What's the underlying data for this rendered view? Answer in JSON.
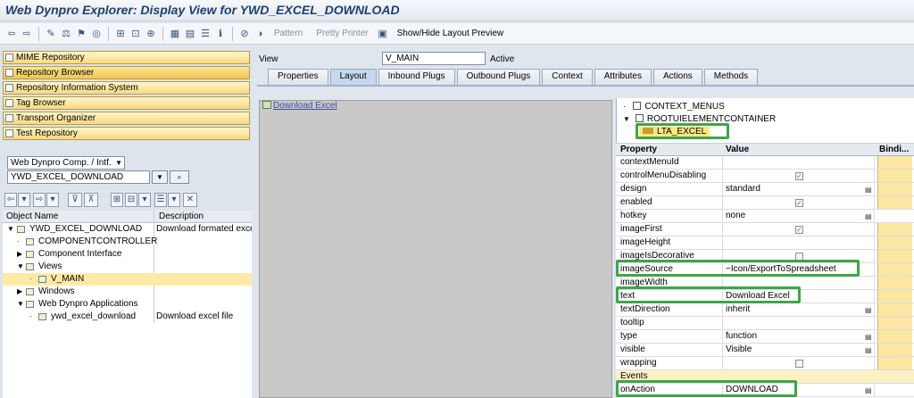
{
  "window": {
    "title": "Web Dynpro Explorer: Display View for YWD_EXCEL_DOWNLOAD"
  },
  "toolbar": {
    "pattern_label": "Pattern",
    "pretty_printer_label": "Pretty Printer",
    "layout_preview_label": "Show/Hide Layout Preview"
  },
  "nav": {
    "items": [
      {
        "label": "MIME Repository"
      },
      {
        "label": "Repository Browser"
      },
      {
        "label": "Repository Information System"
      },
      {
        "label": "Tag Browser"
      },
      {
        "label": "Transport Organizer"
      },
      {
        "label": "Test Repository"
      }
    ]
  },
  "browser": {
    "object_type": "Web Dynpro Comp. / Intf.",
    "object_name": "YWD_EXCEL_DOWNLOAD",
    "columns": {
      "name": "Object Name",
      "description": "Description"
    },
    "tree": [
      {
        "label": "YWD_EXCEL_DOWNLOAD",
        "description": "Download formated exce"
      },
      {
        "label": "COMPONENTCONTROLLER",
        "description": ""
      },
      {
        "label": "Component Interface",
        "description": ""
      },
      {
        "label": "Views",
        "description": ""
      },
      {
        "label": "V_MAIN",
        "description": ""
      },
      {
        "label": "Windows",
        "description": ""
      },
      {
        "label": "Web Dynpro Applications",
        "description": ""
      },
      {
        "label": "ywd_excel_download",
        "description": "Download excel file"
      }
    ]
  },
  "view": {
    "label": "View",
    "name": "V_MAIN",
    "status": "Active",
    "tabs": [
      {
        "label": "Properties"
      },
      {
        "label": "Layout"
      },
      {
        "label": "Inbound Plugs"
      },
      {
        "label": "Outbound Plugs"
      },
      {
        "label": "Context"
      },
      {
        "label": "Attributes"
      },
      {
        "label": "Actions"
      },
      {
        "label": "Methods"
      }
    ]
  },
  "preview": {
    "link_text": "Download Excel"
  },
  "element_tree": {
    "items": [
      {
        "label": "CONTEXT_MENUS"
      },
      {
        "label": "ROOTUIELEMENTCONTAINER"
      },
      {
        "label": "LTA_EXCEL"
      }
    ]
  },
  "properties": {
    "columns": {
      "property": "Property",
      "value": "Value",
      "binding": "Bindi..."
    },
    "rows": [
      {
        "name": "contextMenuId",
        "value": ""
      },
      {
        "name": "controlMenuDisabling",
        "value": ""
      },
      {
        "name": "design",
        "value": "standard"
      },
      {
        "name": "enabled",
        "value": ""
      },
      {
        "name": "hotkey",
        "value": "none"
      },
      {
        "name": "imageFirst",
        "value": ""
      },
      {
        "name": "imageHeight",
        "value": ""
      },
      {
        "name": "imageIsDecorative",
        "value": ""
      },
      {
        "name": "imageSource",
        "value": "~Icon/ExportToSpreadsheet"
      },
      {
        "name": "imageWidth",
        "value": ""
      },
      {
        "name": "text",
        "value": "Download Excel"
      },
      {
        "name": "textDirection",
        "value": "inherit"
      },
      {
        "name": "tooltip",
        "value": ""
      },
      {
        "name": "type",
        "value": "function"
      },
      {
        "name": "visible",
        "value": "Visible"
      },
      {
        "name": "wrapping",
        "value": ""
      }
    ],
    "events_label": "Events",
    "event": {
      "name": "onAction",
      "value": "DOWNLOAD"
    }
  },
  "colors": {
    "highlight": "#3ea547",
    "nav_button": "#f7d980",
    "binding_cell": "#fce8a2"
  }
}
